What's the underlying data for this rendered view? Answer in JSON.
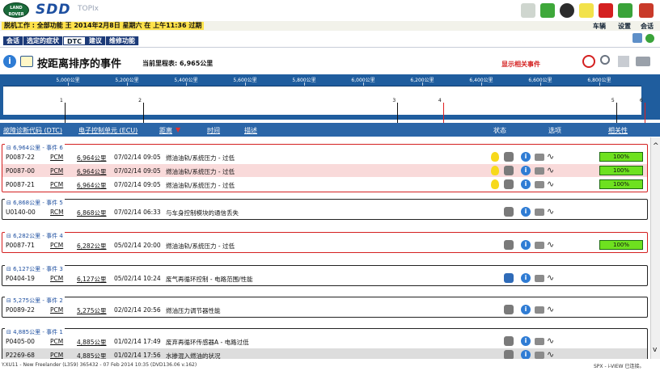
{
  "header": {
    "logo_text": "LAND ROVER",
    "app": "SDD",
    "sub": "TOPIx"
  },
  "status": {
    "text": "脱机工作 : 全部功能 王 2014年2月8日 星期六 在 上午11:36 过期",
    "links": [
      "车辆",
      "设置",
      "会话"
    ]
  },
  "tabs": [
    {
      "label": "会话"
    },
    {
      "label": "选定的症状"
    },
    {
      "label": "DTC",
      "active": true
    },
    {
      "label": "建议"
    },
    {
      "label": "维修功能"
    }
  ],
  "page": {
    "title": "按距离排序的事件",
    "odometer": "当前里程表: 6,965公里",
    "show_related": "显示相关事件"
  },
  "timeline": {
    "ticks": [
      "5,000公里",
      "5,200公里",
      "5,400公里",
      "5,600公里",
      "5,800公里",
      "6,000公里",
      "6,200公里",
      "6,400公里",
      "6,600公里",
      "6,800公里"
    ],
    "events": [
      {
        "n": "1",
        "km": 5000
      },
      {
        "n": "2",
        "km": 5266
      },
      {
        "n": "3",
        "km": 6127
      },
      {
        "n": "4",
        "km": 6282
      },
      {
        "n": "5",
        "km": 6868
      },
      {
        "n": "6",
        "km": 6964
      }
    ]
  },
  "columns": {
    "dtc": "故障诊断代码 (DTC)",
    "ecu": "电子控制单元 (ECU)",
    "distance": "距离",
    "time": "时间",
    "desc": "描述",
    "status": "状态",
    "options": "选项",
    "relevance": "相关性"
  },
  "groups": [
    {
      "label": "6,964公里 - 事件 6",
      "related": true,
      "rows": [
        {
          "dtc": "P0087-22",
          "ecu": "PCM",
          "dist": "6,964公里",
          "time": "07/02/14 09:05",
          "desc": "燃油油轨/系统压力 - 过低",
          "bulb": true,
          "rel": "100%"
        },
        {
          "dtc": "P0087-00",
          "ecu": "PCM",
          "dist": "6,964公里",
          "time": "07/02/14 09:05",
          "desc": "燃油油轨/系统压力 - 过低",
          "bulb": true,
          "rel": "100%",
          "hl": true
        },
        {
          "dtc": "P0087-21",
          "ecu": "PCM",
          "dist": "6,964公里",
          "time": "07/02/14 09:05",
          "desc": "燃油油轨/系统压力 - 过低",
          "bulb": true,
          "rel": "100%"
        }
      ]
    },
    {
      "label": "6,868公里 - 事件 5",
      "related": false,
      "rows": [
        {
          "dtc": "U0140-00",
          "ecu": "RCM",
          "dist": "6,868公里",
          "time": "07/02/14 06:33",
          "desc": "与车身控制模块的通信丢失"
        }
      ]
    },
    {
      "label": "6,282公里 - 事件 4",
      "related": true,
      "rows": [
        {
          "dtc": "P0087-71",
          "ecu": "PCM",
          "dist": "6,282公里",
          "time": "05/02/14 20:00",
          "desc": "燃油油轨/系统压力 - 过低",
          "rel": "100%"
        }
      ]
    },
    {
      "label": "6,127公里 - 事件 3",
      "related": false,
      "rows": [
        {
          "dtc": "P0404-19",
          "ecu": "PCM",
          "dist": "6,127公里",
          "time": "05/02/14 10:24",
          "desc": "废气再循环控制 - 电路范围/性能"
        }
      ]
    },
    {
      "label": "5,275公里 - 事件 2",
      "related": false,
      "rows": [
        {
          "dtc": "P0089-22",
          "ecu": "PCM",
          "dist": "5,275公里",
          "time": "02/02/14 20:56",
          "desc": "燃油压力调节器性能"
        }
      ]
    },
    {
      "label": "4,885公里 - 事件 1",
      "related": false,
      "rows": [
        {
          "dtc": "P0405-00",
          "ecu": "PCM",
          "dist": "4,885公里",
          "time": "01/02/14 17:49",
          "desc": "废弃再循环传感器A - 电路过低"
        },
        {
          "dtc": "P2269-68",
          "ecu": "PCM",
          "dist": "4,885公里",
          "time": "01/02/14 17:56",
          "desc": "水掺混入燃油的状况",
          "gray": true
        }
      ]
    }
  ],
  "footer": {
    "left": "Y.XU11 - New Freelander (L359) 365432 - 07 Feb 2014 10:35 (DVD136.06 v.162)",
    "right": "SPX - i-VIEW 已连接。"
  },
  "colors": {
    "navy": "#1c3a78",
    "timeline": "#1f5d9e",
    "related_border": "#d42020",
    "relevance_green": "#6ee11f"
  }
}
